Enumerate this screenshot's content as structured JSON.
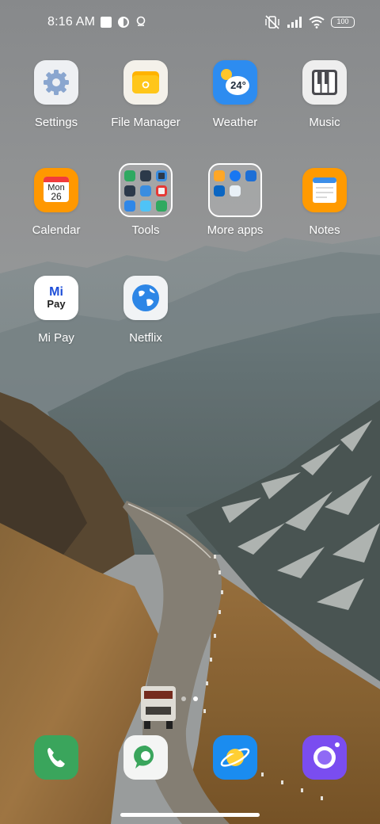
{
  "status_bar": {
    "time": "8:16 AM",
    "battery": "100",
    "left_icons": [
      "stop-square-icon",
      "timer-app-icon",
      "location-pin-icon"
    ],
    "right_icons": [
      "vibrate-muted-icon",
      "cellular-signal-icon",
      "wifi-icon",
      "battery-icon"
    ]
  },
  "apps": [
    {
      "label": "Settings",
      "icon": "gear-icon"
    },
    {
      "label": "File Manager",
      "icon": "folder-icon"
    },
    {
      "label": "Weather",
      "icon": "weather-icon",
      "badge": "24°"
    },
    {
      "label": "Music",
      "icon": "piano-keys-icon"
    },
    {
      "label": "Calendar",
      "icon": "calendar-icon",
      "day": "Mon",
      "date": "26"
    },
    {
      "label": "Tools",
      "icon": "folder-grid-icon"
    },
    {
      "label": "More apps",
      "icon": "folder-grid-icon"
    },
    {
      "label": "Notes",
      "icon": "notepad-icon"
    },
    {
      "label": "Mi Pay",
      "icon": "mipay-icon",
      "brand_top": "Mi",
      "brand_bottom": "Pay"
    },
    {
      "label": "Netflix",
      "icon": "globe-icon"
    }
  ],
  "dock": [
    {
      "name": "phone",
      "icon": "phone-icon"
    },
    {
      "name": "messages",
      "icon": "message-icon"
    },
    {
      "name": "browser",
      "icon": "planet-icon"
    },
    {
      "name": "camera",
      "icon": "camera-icon"
    }
  ],
  "pages": {
    "count": 2,
    "active": 2
  },
  "colors": {
    "settings_bg": "#eef0f3",
    "file_manager": "#ffc21a",
    "weather": "#2d8cf0",
    "calendar": "#ff9800",
    "notes": "#ff9a00",
    "netflix_globe": "#2d86e6",
    "phone": "#3aa55c",
    "browser": "#1a8cf0",
    "camera": "#7a4df0"
  }
}
